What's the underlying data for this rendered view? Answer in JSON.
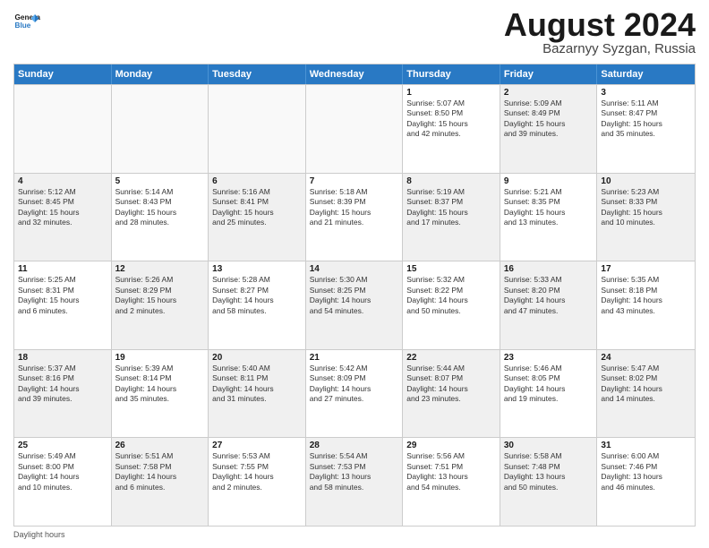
{
  "logo": {
    "line1": "General",
    "line2": "Blue"
  },
  "title": "August 2024",
  "subtitle": "Bazarnyy Syzgan, Russia",
  "weekdays": [
    "Sunday",
    "Monday",
    "Tuesday",
    "Wednesday",
    "Thursday",
    "Friday",
    "Saturday"
  ],
  "weeks": [
    [
      {
        "day": "",
        "info": "",
        "shaded": false,
        "empty": true
      },
      {
        "day": "",
        "info": "",
        "shaded": false,
        "empty": true
      },
      {
        "day": "",
        "info": "",
        "shaded": false,
        "empty": true
      },
      {
        "day": "",
        "info": "",
        "shaded": false,
        "empty": true
      },
      {
        "day": "1",
        "info": "Sunrise: 5:07 AM\nSunset: 8:50 PM\nDaylight: 15 hours\nand 42 minutes.",
        "shaded": false,
        "empty": false
      },
      {
        "day": "2",
        "info": "Sunrise: 5:09 AM\nSunset: 8:49 PM\nDaylight: 15 hours\nand 39 minutes.",
        "shaded": true,
        "empty": false
      },
      {
        "day": "3",
        "info": "Sunrise: 5:11 AM\nSunset: 8:47 PM\nDaylight: 15 hours\nand 35 minutes.",
        "shaded": false,
        "empty": false
      }
    ],
    [
      {
        "day": "4",
        "info": "Sunrise: 5:12 AM\nSunset: 8:45 PM\nDaylight: 15 hours\nand 32 minutes.",
        "shaded": true,
        "empty": false
      },
      {
        "day": "5",
        "info": "Sunrise: 5:14 AM\nSunset: 8:43 PM\nDaylight: 15 hours\nand 28 minutes.",
        "shaded": false,
        "empty": false
      },
      {
        "day": "6",
        "info": "Sunrise: 5:16 AM\nSunset: 8:41 PM\nDaylight: 15 hours\nand 25 minutes.",
        "shaded": true,
        "empty": false
      },
      {
        "day": "7",
        "info": "Sunrise: 5:18 AM\nSunset: 8:39 PM\nDaylight: 15 hours\nand 21 minutes.",
        "shaded": false,
        "empty": false
      },
      {
        "day": "8",
        "info": "Sunrise: 5:19 AM\nSunset: 8:37 PM\nDaylight: 15 hours\nand 17 minutes.",
        "shaded": true,
        "empty": false
      },
      {
        "day": "9",
        "info": "Sunrise: 5:21 AM\nSunset: 8:35 PM\nDaylight: 15 hours\nand 13 minutes.",
        "shaded": false,
        "empty": false
      },
      {
        "day": "10",
        "info": "Sunrise: 5:23 AM\nSunset: 8:33 PM\nDaylight: 15 hours\nand 10 minutes.",
        "shaded": true,
        "empty": false
      }
    ],
    [
      {
        "day": "11",
        "info": "Sunrise: 5:25 AM\nSunset: 8:31 PM\nDaylight: 15 hours\nand 6 minutes.",
        "shaded": false,
        "empty": false
      },
      {
        "day": "12",
        "info": "Sunrise: 5:26 AM\nSunset: 8:29 PM\nDaylight: 15 hours\nand 2 minutes.",
        "shaded": true,
        "empty": false
      },
      {
        "day": "13",
        "info": "Sunrise: 5:28 AM\nSunset: 8:27 PM\nDaylight: 14 hours\nand 58 minutes.",
        "shaded": false,
        "empty": false
      },
      {
        "day": "14",
        "info": "Sunrise: 5:30 AM\nSunset: 8:25 PM\nDaylight: 14 hours\nand 54 minutes.",
        "shaded": true,
        "empty": false
      },
      {
        "day": "15",
        "info": "Sunrise: 5:32 AM\nSunset: 8:22 PM\nDaylight: 14 hours\nand 50 minutes.",
        "shaded": false,
        "empty": false
      },
      {
        "day": "16",
        "info": "Sunrise: 5:33 AM\nSunset: 8:20 PM\nDaylight: 14 hours\nand 47 minutes.",
        "shaded": true,
        "empty": false
      },
      {
        "day": "17",
        "info": "Sunrise: 5:35 AM\nSunset: 8:18 PM\nDaylight: 14 hours\nand 43 minutes.",
        "shaded": false,
        "empty": false
      }
    ],
    [
      {
        "day": "18",
        "info": "Sunrise: 5:37 AM\nSunset: 8:16 PM\nDaylight: 14 hours\nand 39 minutes.",
        "shaded": true,
        "empty": false
      },
      {
        "day": "19",
        "info": "Sunrise: 5:39 AM\nSunset: 8:14 PM\nDaylight: 14 hours\nand 35 minutes.",
        "shaded": false,
        "empty": false
      },
      {
        "day": "20",
        "info": "Sunrise: 5:40 AM\nSunset: 8:11 PM\nDaylight: 14 hours\nand 31 minutes.",
        "shaded": true,
        "empty": false
      },
      {
        "day": "21",
        "info": "Sunrise: 5:42 AM\nSunset: 8:09 PM\nDaylight: 14 hours\nand 27 minutes.",
        "shaded": false,
        "empty": false
      },
      {
        "day": "22",
        "info": "Sunrise: 5:44 AM\nSunset: 8:07 PM\nDaylight: 14 hours\nand 23 minutes.",
        "shaded": true,
        "empty": false
      },
      {
        "day": "23",
        "info": "Sunrise: 5:46 AM\nSunset: 8:05 PM\nDaylight: 14 hours\nand 19 minutes.",
        "shaded": false,
        "empty": false
      },
      {
        "day": "24",
        "info": "Sunrise: 5:47 AM\nSunset: 8:02 PM\nDaylight: 14 hours\nand 14 minutes.",
        "shaded": true,
        "empty": false
      }
    ],
    [
      {
        "day": "25",
        "info": "Sunrise: 5:49 AM\nSunset: 8:00 PM\nDaylight: 14 hours\nand 10 minutes.",
        "shaded": false,
        "empty": false
      },
      {
        "day": "26",
        "info": "Sunrise: 5:51 AM\nSunset: 7:58 PM\nDaylight: 14 hours\nand 6 minutes.",
        "shaded": true,
        "empty": false
      },
      {
        "day": "27",
        "info": "Sunrise: 5:53 AM\nSunset: 7:55 PM\nDaylight: 14 hours\nand 2 minutes.",
        "shaded": false,
        "empty": false
      },
      {
        "day": "28",
        "info": "Sunrise: 5:54 AM\nSunset: 7:53 PM\nDaylight: 13 hours\nand 58 minutes.",
        "shaded": true,
        "empty": false
      },
      {
        "day": "29",
        "info": "Sunrise: 5:56 AM\nSunset: 7:51 PM\nDaylight: 13 hours\nand 54 minutes.",
        "shaded": false,
        "empty": false
      },
      {
        "day": "30",
        "info": "Sunrise: 5:58 AM\nSunset: 7:48 PM\nDaylight: 13 hours\nand 50 minutes.",
        "shaded": true,
        "empty": false
      },
      {
        "day": "31",
        "info": "Sunrise: 6:00 AM\nSunset: 7:46 PM\nDaylight: 13 hours\nand 46 minutes.",
        "shaded": false,
        "empty": false
      }
    ]
  ],
  "footer": "Daylight hours"
}
